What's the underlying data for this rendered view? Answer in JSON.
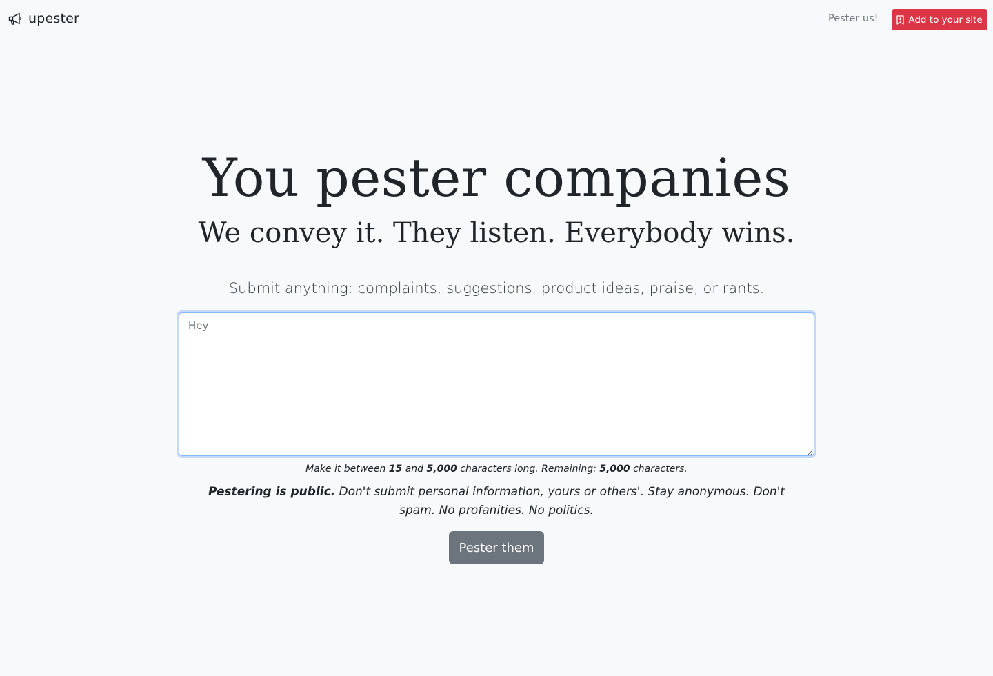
{
  "navbar": {
    "brand": "upester",
    "brand_icon": "megaphone-icon",
    "link_label": "Pester us!",
    "cta_label": "Add to your site",
    "cta_icon": "bookmark-plus-icon",
    "cta_color": "#dc3545"
  },
  "hero": {
    "title": "You pester companies",
    "subtitle": "We convey it. They listen. Everybody wins."
  },
  "form": {
    "lead": "Submit anything: complaints, suggestions, product ideas, praise, or rants.",
    "textarea_placeholder": "Hey",
    "help": {
      "prefix": "Make it between ",
      "min": "15",
      "and": " and ",
      "max": "5,000",
      "middle": " characters long. Remaining: ",
      "remaining": "5,000",
      "suffix": " characters."
    },
    "warning": {
      "bold": "Pestering is public.",
      "text": " Don't submit personal information, yours or others'. Stay anonymous. Don't spam. No profanities. No politics."
    },
    "submit_label": "Pester them",
    "submit_color": "#6c757d"
  }
}
